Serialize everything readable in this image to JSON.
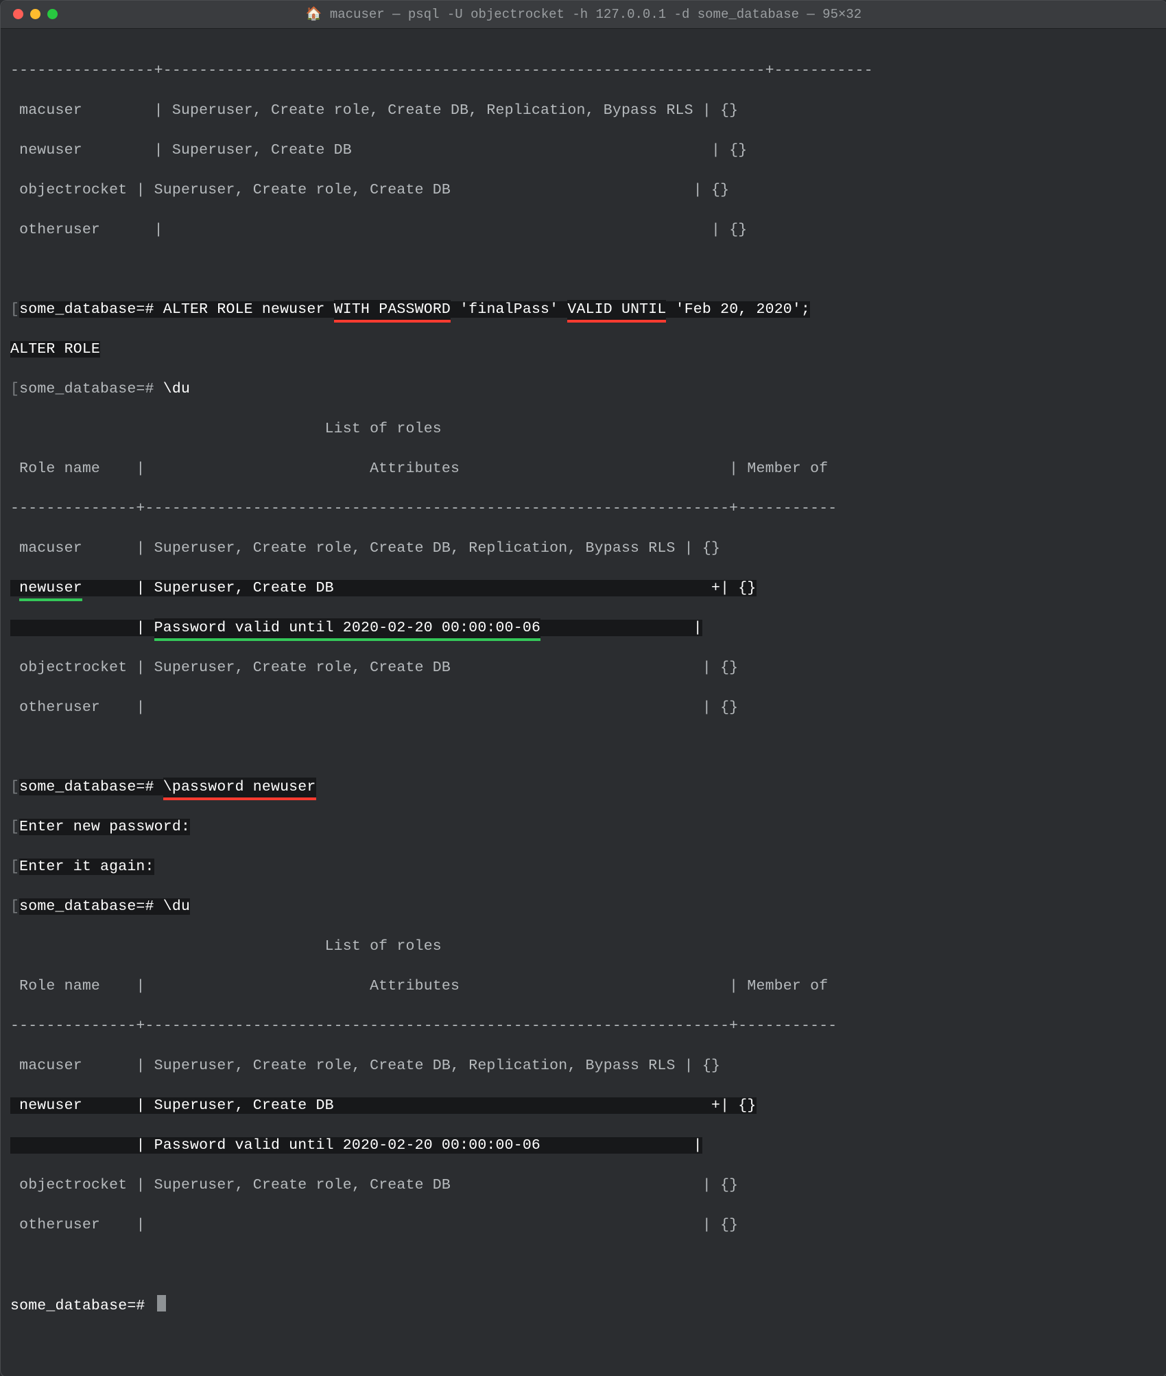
{
  "titlebar": {
    "title": "🏠 macuser — psql -U objectrocket -h 127.0.0.1 -d some_database — 95×32"
  },
  "sep": {
    "top": "----------------+-------------------------------------------------------------------+-----------",
    "t2": "--------------+-----------------------------------------------------------------+-----------",
    "t3": "--------------+-----------------------------------------------------------------+-----------"
  },
  "t1": {
    "r1c1": " macuser        ",
    "r1c2": "| Superuser, Create role, Create DB, Replication, Bypass RLS ",
    "r1c3": "| {}",
    "r2c1": " newuser        ",
    "r2c2": "| Superuser, Create DB                                        ",
    "r2c3": "| {}",
    "r3c1": " objectrocket ",
    "r3c2": "| Superuser, Create role, Create DB                           ",
    "r3c3": "| {}",
    "r4c1": " otheruser      ",
    "r4c2": "|                                                             ",
    "r4c3": "| {}"
  },
  "cmd1": {
    "prompt": "some_database=# ",
    "p1": "ALTER ROLE newuser ",
    "u1": "WITH PASSWORD",
    "p2": " 'finalPass' ",
    "u2": "VALID UNTIL",
    "p3": " 'Feb 20, 2020';"
  },
  "resp1": "ALTER ROLE",
  "cmd2": {
    "prompt": "some_database=# ",
    "body": "\\du"
  },
  "header2": {
    "title": "                                   List of roles",
    "cols": " Role name    |                         Attributes                              | Member of "
  },
  "t2": {
    "r1c1": " macuser      ",
    "r1c2": "| Superuser, Create role, Create DB, Replication, Bypass RLS ",
    "r1c3": "| {}",
    "r2c1": " newuser      ",
    "r2c2": "| Superuser, Create DB                                          +",
    "r2c3": "| {}",
    "r2bc1": "              ",
    "r2bc2": "| ",
    "r2bu": "Password valid until 2020-02-20 00:00:00-06",
    "r2bpad": "                 ",
    "r2bc3": "|",
    "r3c1": " objectrocket ",
    "r3c2": "| Superuser, Create role, Create DB                            ",
    "r3c3": "| {}",
    "r4c1": " otheruser    ",
    "r4c2": "|                                                              ",
    "r4c3": "| {}"
  },
  "cmd3": {
    "prompt": "some_database=# ",
    "u": "\\password newuser"
  },
  "pw": {
    "l1": "Enter new password:",
    "l2": "Enter it again:"
  },
  "cmd4": {
    "prompt": "some_database=# ",
    "body": "\\du"
  },
  "header3": {
    "title": "                                   List of roles",
    "cols": " Role name    |                         Attributes                              | Member of "
  },
  "t3": {
    "r1c1": " macuser      ",
    "r1c2": "| Superuser, Create role, Create DB, Replication, Bypass RLS ",
    "r1c3": "| {}",
    "r2c1": " newuser      ",
    "r2c2": "| Superuser, Create DB                                          +",
    "r2c3": "| {}",
    "r2bc1": "              ",
    "r2bc2": "| Password valid until 2020-02-20 00:00:00-06                 ",
    "r2bc3": "|",
    "r3c1": " objectrocket ",
    "r3c2": "| Superuser, Create role, Create DB                            ",
    "r3c3": "| {}",
    "r4c1": " otheruser    ",
    "r4c2": "|                                                              ",
    "r4c3": "| {}"
  },
  "final": {
    "prompt": "some_database=# "
  }
}
